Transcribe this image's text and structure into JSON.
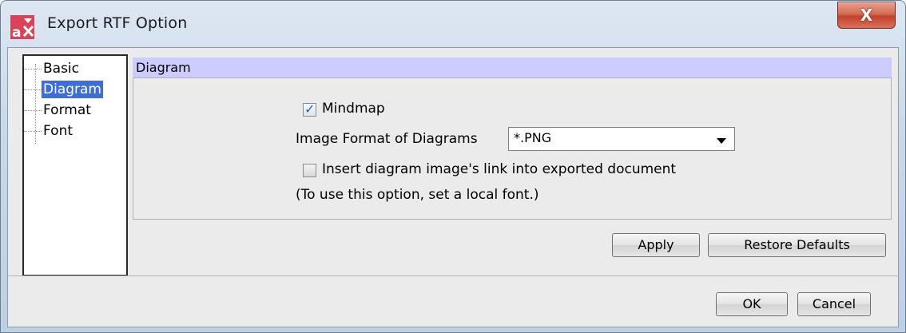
{
  "window": {
    "title": "Export RTF Option",
    "close_label": "X"
  },
  "tree": {
    "items": [
      {
        "label": "Basic",
        "selected": false
      },
      {
        "label": "Diagram",
        "selected": true
      },
      {
        "label": "Format",
        "selected": false
      },
      {
        "label": "Font",
        "selected": false
      }
    ]
  },
  "section": {
    "title": "Diagram",
    "mindmap_label": "Mindmap",
    "mindmap_checked": true,
    "image_format_label": "Image Format of Diagrams",
    "image_format_value": "*.PNG",
    "insert_link_label": "Insert diagram image's link into exported document",
    "insert_link_checked": false,
    "note": "(To use this option, set a local font.)"
  },
  "buttons": {
    "apply": "Apply",
    "restore_defaults": "Restore Defaults",
    "ok": "OK",
    "cancel": "Cancel"
  },
  "colors": {
    "section_header_bg": "#ccccff",
    "selection_bg": "#3e6fd6",
    "close_button": "#c2422b"
  }
}
